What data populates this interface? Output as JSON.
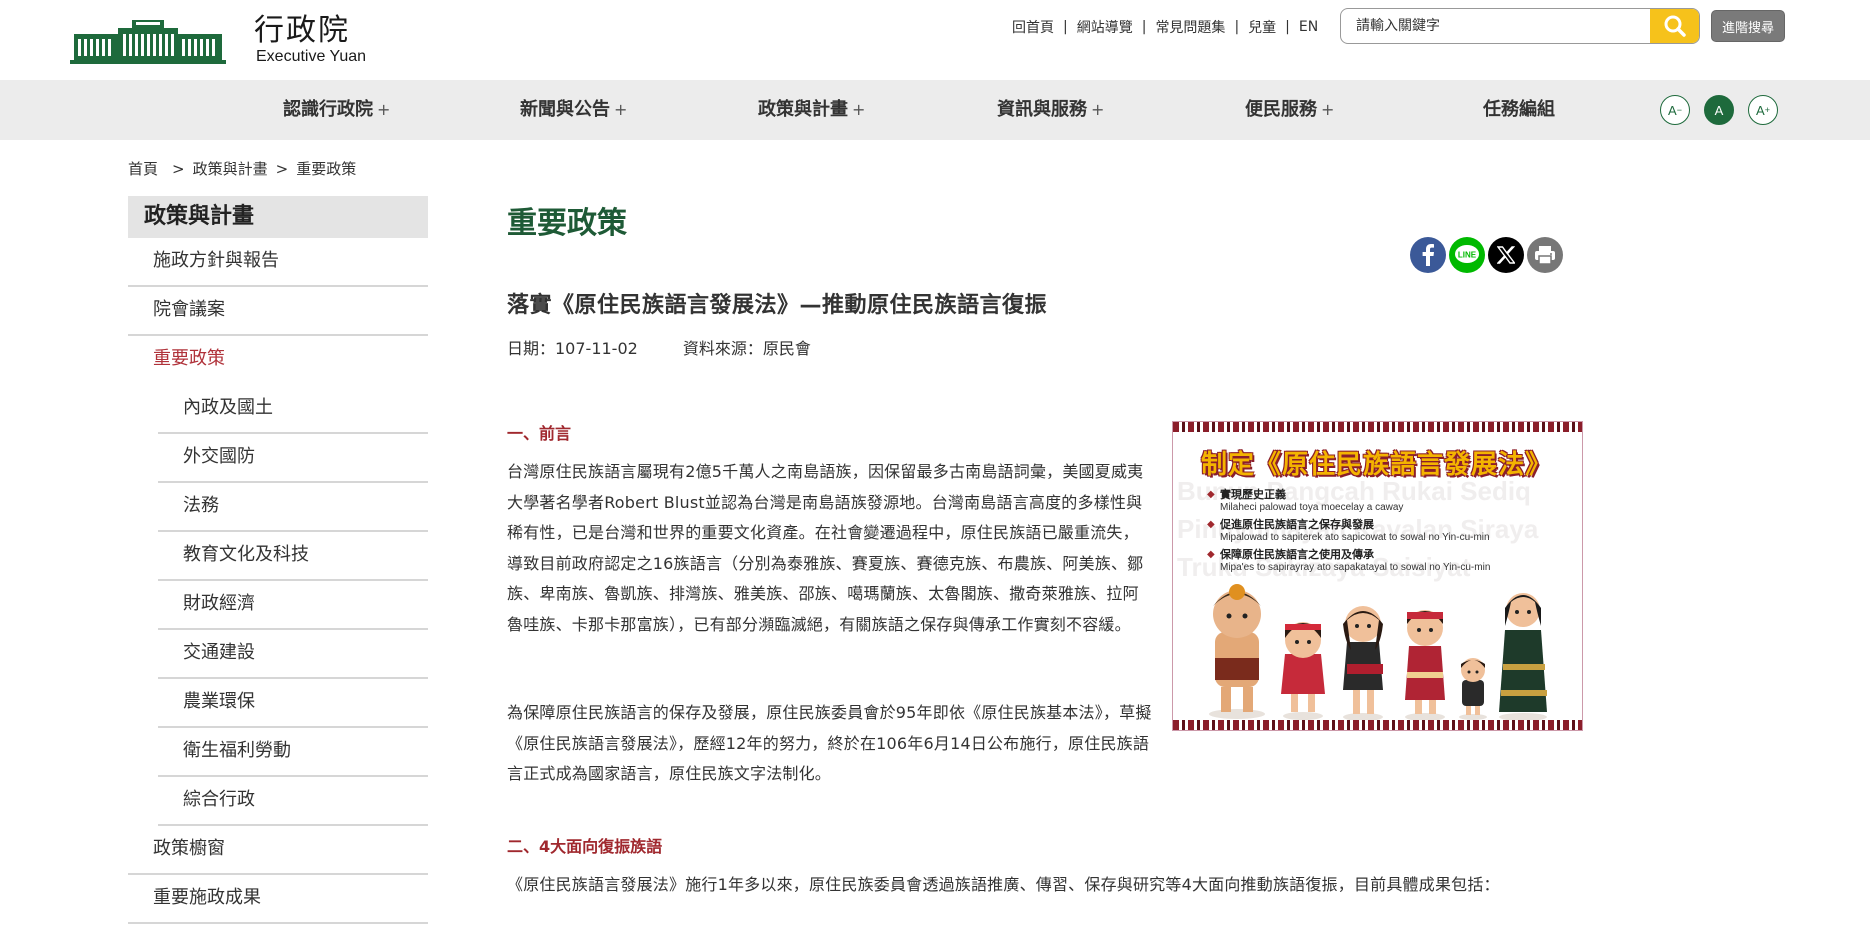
{
  "header": {
    "logo_title": "行政院",
    "logo_subtitle": "Executive Yuan",
    "top_links": [
      "回首頁",
      "網站導覽",
      "常見問題集",
      "兒童",
      "EN"
    ],
    "search_placeholder": "請輸入關鍵字",
    "advanced_search_label": "進階搜尋"
  },
  "nav": {
    "items": [
      {
        "label": "認識行政院",
        "plus": "+"
      },
      {
        "label": "新聞與公告",
        "plus": "+"
      },
      {
        "label": "政策與計畫",
        "plus": "+"
      },
      {
        "label": "資訊與服務",
        "plus": "+"
      },
      {
        "label": "便民服務",
        "plus": "+"
      },
      {
        "label": "任務編組",
        "plus": ""
      }
    ],
    "font_sizes": [
      {
        "label": "A",
        "sup": "−"
      },
      {
        "label": "A",
        "sup": ""
      },
      {
        "label": "A",
        "sup": "+"
      }
    ]
  },
  "breadcrumb": [
    "首頁",
    "政策與計畫",
    "重要政策"
  ],
  "breadcrumb_sep": ">",
  "sidebar": {
    "heading": "政策與計畫",
    "items": [
      {
        "label": "施政方針與報告"
      },
      {
        "label": "院會議案"
      },
      {
        "label": "重要政策"
      },
      {
        "label": "內政及國土"
      },
      {
        "label": "外交國防"
      },
      {
        "label": "法務"
      },
      {
        "label": "教育文化及科技"
      },
      {
        "label": "財政經濟"
      },
      {
        "label": "交通建設"
      },
      {
        "label": "農業環保"
      },
      {
        "label": "衛生福利勞動"
      },
      {
        "label": "綜合行政"
      },
      {
        "label": "政策櫥窗"
      },
      {
        "label": "重要施政成果"
      }
    ]
  },
  "main": {
    "page_title": "重要政策",
    "share_icons": [
      "facebook-icon",
      "line-icon",
      "x-icon",
      "print-icon"
    ],
    "share_line_text": "LINE",
    "article_title": "落實《原住民族語言發展法》—推動原住民族語言復振",
    "date_label": "日期：107-11-02",
    "source_label": "資料來源：原民會",
    "section1_title": "一、前言",
    "para1": "台灣原住民族語言屬現有2億5千萬人之南島語族，因保留最多古南島語詞彙，美國夏威夷大學著名學者Robert Blust並認為台灣是南島語族發源地。台灣南島語言高度的多樣性與稀有性，已是台灣和世界的重要文化資產。在社會變遷過程中，原住民族語已嚴重流失，導致目前政府認定之16族語言（分別為泰雅族、賽夏族、賽德克族、布農族、阿美族、鄒族、卑南族、魯凱族、排灣族、雅美族、邵族、噶瑪蘭族、太魯閣族、撒奇萊雅族、拉阿魯哇族、卡那卡那富族），已有部分瀕臨滅絕，有關族語之保存與傳承工作實刻不容緩。",
    "para2": "為保障原住民族語言的保存及發展，原住民族委員會於95年即依《原住民族基本法》，草擬《原住民族語言發展法》，歷經12年的努力，終於在106年6月14日公布施行，原住民族語言正式成為國家語言，原住民族文字法制化。",
    "section2_title": "二、4大面向復振族語",
    "para3": "《原住民族語言發展法》施行1年多以來，原住民族委員會透過族語推廣、傳習、保存與研究等4大面向推動族語復振，目前具體成果包括："
  },
  "figure": {
    "title": "制定《原住民族語言發展法》",
    "bullets": [
      {
        "zh": "實現歷史正義",
        "native": "Milaheci palowad toya moecelay a caway"
      },
      {
        "zh": "促進原住民族語言之保存與發展",
        "native": "Mipalowad to sapiterek ato sapicowat to sowal no Yin-cu-min"
      },
      {
        "zh": "保障原住民族語言之使用及傳承",
        "native": "Mipa'es to sapirayray ato sapakatayal to sowal no Yin-cu-min"
      }
    ],
    "watermark": [
      "Bunun Pangcah Rukai Sediq",
      "Pinuyumayan Kavalan Siraya",
      "Truku Sakizaya Saisiyat"
    ]
  },
  "colors": {
    "brand_green": "#1e6a3c",
    "title_green": "#1e5a36",
    "accent_red": "#a0282e",
    "search_yellow": "#f6c21b",
    "nav_bg": "#ececec"
  }
}
